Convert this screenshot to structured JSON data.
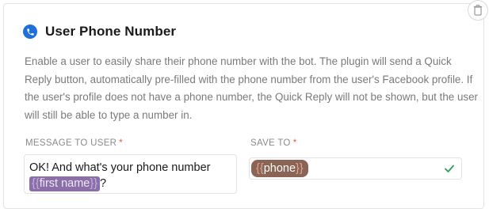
{
  "block": {
    "title": "User Phone Number",
    "description": "Enable a user to easily share their phone number with the bot. The plugin will send a Quick Reply button, automatically pre-filled with the phone number from the user's Facebook profile. If the user's profile does not have a phone number, the Quick Reply will not be shown, but the user will still be able to type a number in.",
    "icons": {
      "title_icon": "phone-icon",
      "delete_icon": "trash-icon",
      "valid_icon": "checkmark-icon"
    }
  },
  "message_field": {
    "label": "MESSAGE TO USER",
    "required_mark": "*",
    "text_before": "OK! And what's your phone number ",
    "tag_open": "{{",
    "tag_name": "first name",
    "tag_close": "}}",
    "text_after": "?"
  },
  "save_field": {
    "label": "SAVE TO",
    "required_mark": "*",
    "tag_open": "{{",
    "tag_name": "phone",
    "tag_close": "}}"
  },
  "colors": {
    "accent_blue": "#1e6fd9",
    "required_red": "#e05a4a",
    "user_attribute_tag": "#8b6fa8",
    "save_attribute_tag": "#8a6455",
    "valid_green": "#2e9e5a"
  }
}
